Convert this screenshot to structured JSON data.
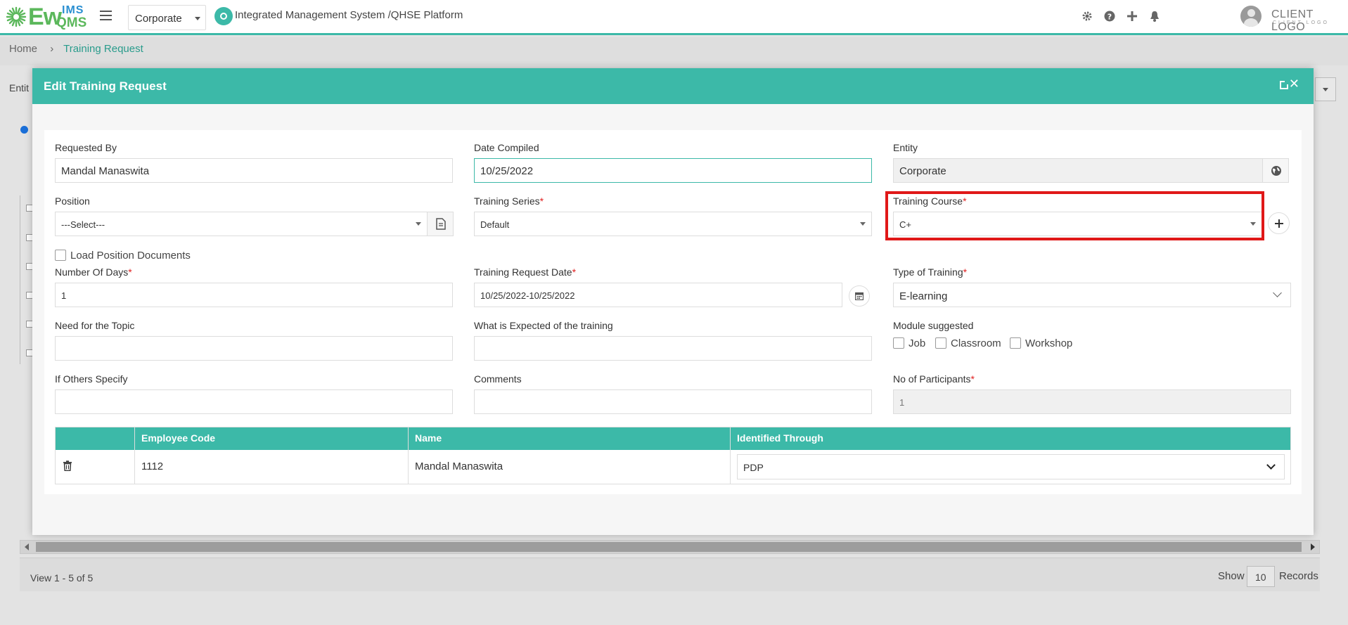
{
  "header": {
    "logo_main": "Ew",
    "logo_ims": "IMS",
    "logo_qms": "QMS",
    "entity_select": "Corporate",
    "app_title": "Integrated Management System /QHSE Platform",
    "client_logo": "CLIENT LOGO",
    "client_logo_sub": "CLIENT LOGO",
    "icons": [
      "gear-icon",
      "help-icon",
      "plus-icon",
      "bell-icon",
      "avatar"
    ]
  },
  "breadcrumb": {
    "home": "Home",
    "separator": "›",
    "current": "Training Request"
  },
  "background": {
    "entity_label": "Entit",
    "view_text": "View 1 - 5 of 5",
    "show_label": "Show",
    "records_value": "10",
    "records_label": "Records"
  },
  "modal": {
    "title": "Edit Training Request",
    "fields": {
      "requested_by": {
        "label": "Requested By",
        "value": "Mandal Manaswita"
      },
      "date_compiled": {
        "label": "Date Compiled",
        "value": "10/25/2022"
      },
      "entity": {
        "label": "Entity",
        "value": "Corporate"
      },
      "position": {
        "label": "Position",
        "value": "---Select---"
      },
      "training_series": {
        "label": "Training Series",
        "value": "Default",
        "required": "*"
      },
      "training_course": {
        "label": "Training Course",
        "value": "C+",
        "required": "*"
      },
      "load_position_docs": {
        "label": "Load Position Documents"
      },
      "number_of_days": {
        "label": "Number Of Days",
        "value": "1",
        "required": "*"
      },
      "training_request_date": {
        "label": "Training Request Date",
        "value": "10/25/2022-10/25/2022",
        "required": "*"
      },
      "type_of_training": {
        "label": "Type of Training",
        "value": "E-learning",
        "required": "*"
      },
      "need_for_topic": {
        "label": "Need for the Topic",
        "value": ""
      },
      "expected": {
        "label": "What is Expected of the training",
        "value": ""
      },
      "module_suggested": {
        "label": "Module suggested",
        "options": [
          "Job",
          "Classroom",
          "Workshop"
        ]
      },
      "if_others": {
        "label": "If Others Specify",
        "value": ""
      },
      "comments": {
        "label": "Comments",
        "value": ""
      },
      "no_of_participants": {
        "label": "No of Participants",
        "value": "1",
        "required": "*"
      }
    },
    "table": {
      "columns": [
        "",
        "Employee Code",
        "Name",
        "Identified Through"
      ],
      "rows": [
        {
          "employee_code": "1112",
          "name": "Mandal Manaswita",
          "identified_through": "PDP"
        }
      ]
    }
  },
  "colors": {
    "accent": "#3cb9a8",
    "required": "#e02020",
    "highlight": "#e01818"
  }
}
